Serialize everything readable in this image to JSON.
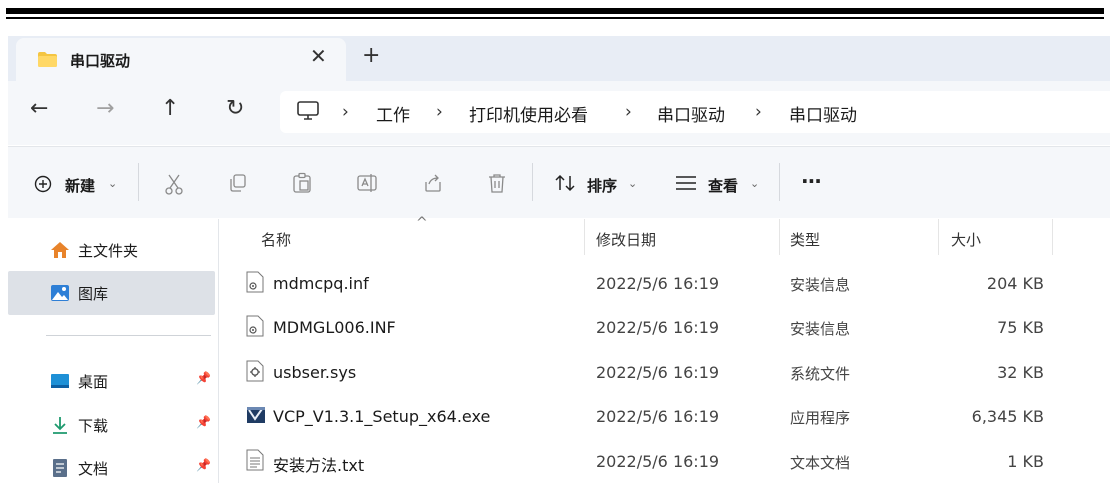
{
  "window": {
    "tab_title": "串口驱动",
    "close_tab": "✕",
    "new_tab": "+"
  },
  "nav": {
    "back": "←",
    "forward": "→",
    "up": "↑",
    "refresh": "↻"
  },
  "breadcrumb": [
    "工作",
    "打印机使用必看",
    "串口驱动",
    "串口驱动"
  ],
  "breadcrumb_sep": "›",
  "toolbar": {
    "new_label": "新建",
    "sort_label": "排序",
    "view_label": "查看",
    "more": "···",
    "chevron": "⌄"
  },
  "sidebar": {
    "items": [
      {
        "label": "主文件夹",
        "icon": "home-icon"
      },
      {
        "label": "图库",
        "icon": "gallery-icon",
        "selected": true
      },
      {
        "label": "桌面",
        "icon": "desktop-icon",
        "pinned": true
      },
      {
        "label": "下载",
        "icon": "download-icon",
        "pinned": true
      },
      {
        "label": "文档",
        "icon": "document-icon",
        "pinned": true
      }
    ],
    "pin_glyph": "📌"
  },
  "columns": {
    "name": "名称",
    "modified": "修改日期",
    "type": "类型",
    "size": "大小",
    "sort_indicator": "^"
  },
  "files": [
    {
      "name": "mdmcpq.inf",
      "modified": "2022/5/6 16:19",
      "type": "安装信息",
      "size": "204 KB",
      "icon": "inf-file-icon"
    },
    {
      "name": "MDMGL006.INF",
      "modified": "2022/5/6 16:19",
      "type": "安装信息",
      "size": "75 KB",
      "icon": "inf-file-icon"
    },
    {
      "name": "usbser.sys",
      "modified": "2022/5/6 16:19",
      "type": "系统文件",
      "size": "32 KB",
      "icon": "sys-file-icon"
    },
    {
      "name": "VCP_V1.3.1_Setup_x64.exe",
      "modified": "2022/5/6 16:19",
      "type": "应用程序",
      "size": "6,345 KB",
      "icon": "exe-file-icon"
    },
    {
      "name": "安装方法.txt",
      "modified": "2022/5/6 16:19",
      "type": "文本文档",
      "size": "1 KB",
      "icon": "txt-file-icon"
    }
  ],
  "colors": {
    "tabstrip": "#e8edf5",
    "toolbar": "#f5f7fa",
    "selection": "#dde1e7",
    "folder": "#f4c542"
  }
}
